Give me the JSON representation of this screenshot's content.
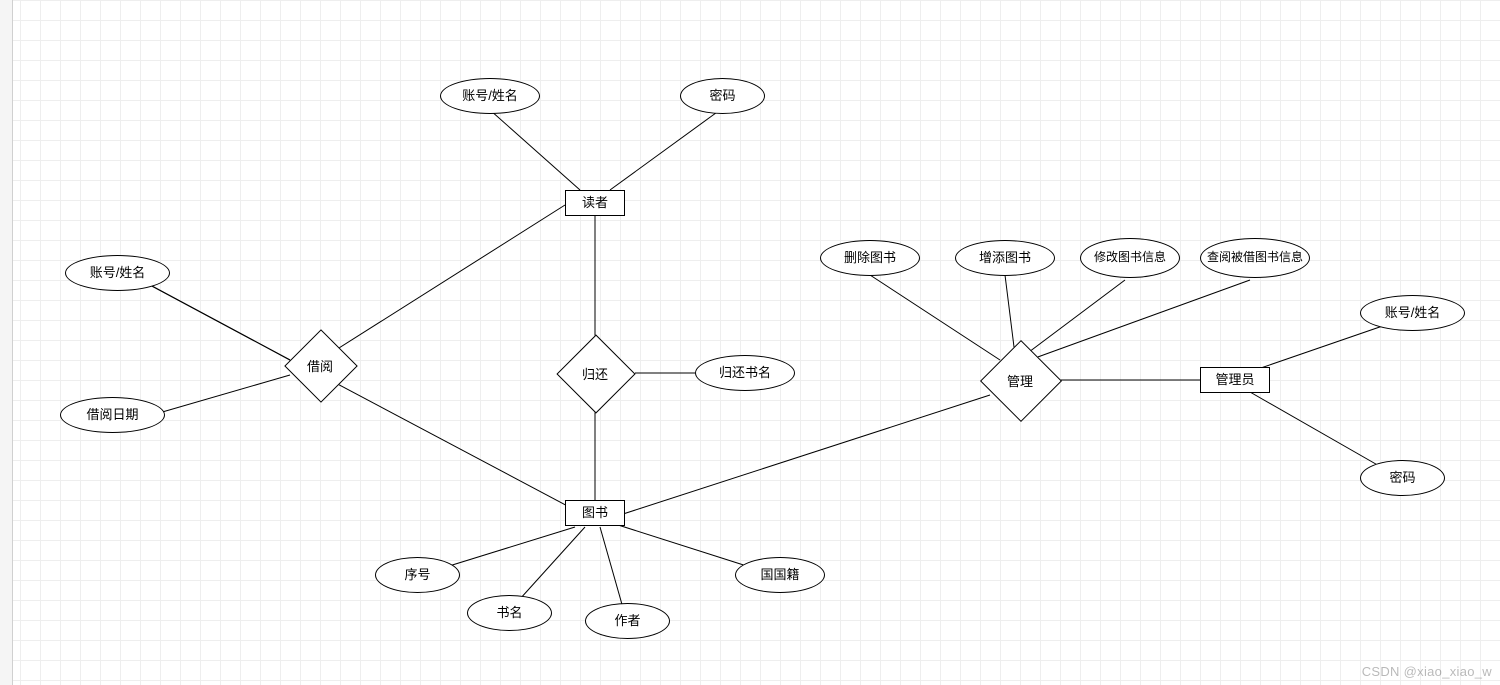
{
  "watermark": "CSDN @xiao_xiao_w",
  "entities": {
    "reader": "读者",
    "book": "图书",
    "admin": "管理员"
  },
  "relationships": {
    "borrow": "借阅",
    "return": "归还",
    "manage": "管理"
  },
  "attributes": {
    "reader_account_name": "账号/姓名",
    "reader_password": "密码",
    "borrow_account_name": "账号/姓名",
    "borrow_date": "借阅日期",
    "return_book_name": "归还书名",
    "book_serial": "序号",
    "book_name": "书名",
    "book_author": "作者",
    "book_nationality": "国国籍",
    "manage_delete": "删除图书",
    "manage_add": "增添图书",
    "manage_modify": "修改图书信息",
    "manage_query_borrowed": "查阅被借图书信息",
    "admin_account_name": "账号/姓名",
    "admin_password": "密码"
  }
}
